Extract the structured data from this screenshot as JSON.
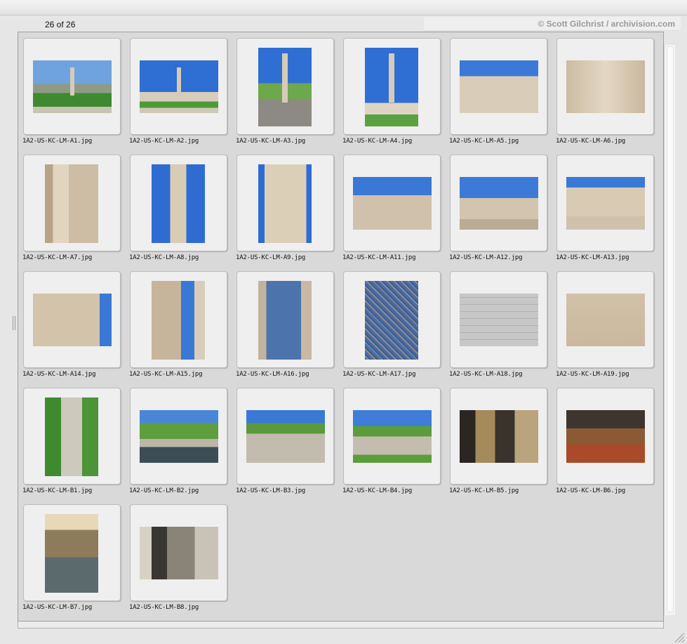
{
  "header": {
    "count": "26 of 26",
    "credit": "© Scott Gilchrist / archivision.com"
  },
  "thumbnails": [
    {
      "name": "1A2-US-KC-LM-A1.jpg",
      "scene": "memorial-distant-lawn"
    },
    {
      "name": "1A2-US-KC-LM-A2.jpg",
      "scene": "tower-wide-lawn"
    },
    {
      "name": "1A2-US-KC-LM-A3.jpg",
      "scene": "tower-path-portrait"
    },
    {
      "name": "1A2-US-KC-LM-A4.jpg",
      "scene": "tower-portrait-city"
    },
    {
      "name": "1A2-US-KC-LM-A5.jpg",
      "scene": "tower-base-terrace"
    },
    {
      "name": "1A2-US-KC-LM-A6.jpg",
      "scene": "tower-base-closeup"
    },
    {
      "name": "1A2-US-KC-LM-A7.jpg",
      "scene": "inscription-wall"
    },
    {
      "name": "1A2-US-KC-LM-A8.jpg",
      "scene": "tower-shaft"
    },
    {
      "name": "1A2-US-KC-LM-A9.jpg",
      "scene": "tower-shaft-detail"
    },
    {
      "name": "1A2-US-KC-LM-A11.jpg",
      "scene": "sphinx-terrace"
    },
    {
      "name": "1A2-US-KC-LM-A12.jpg",
      "scene": "sphinx-closeup"
    },
    {
      "name": "1A2-US-KC-LM-A13.jpg",
      "scene": "pavilion-building"
    },
    {
      "name": "1A2-US-KC-LM-A14.jpg",
      "scene": "building-windows"
    },
    {
      "name": "1A2-US-KC-LM-A15.jpg",
      "scene": "urn-colonnade"
    },
    {
      "name": "1A2-US-KC-LM-A16.jpg",
      "scene": "blue-tile-lantern"
    },
    {
      "name": "1A2-US-KC-LM-A17.jpg",
      "scene": "mosaic-panel"
    },
    {
      "name": "1A2-US-KC-LM-A18.jpg",
      "scene": "paving-plaque"
    },
    {
      "name": "1A2-US-KC-LM-A19.jpg",
      "scene": "stone-wall"
    },
    {
      "name": "1A2-US-KC-LM-B1.jpg",
      "scene": "aerial-mall"
    },
    {
      "name": "1A2-US-KC-LM-B2.jpg",
      "scene": "pool-terraces"
    },
    {
      "name": "1A2-US-KC-LM-B3.jpg",
      "scene": "round-pool"
    },
    {
      "name": "1A2-US-KC-LM-B4.jpg",
      "scene": "round-pool-lawn"
    },
    {
      "name": "1A2-US-KC-LM-B5.jpg",
      "scene": "interior-dark"
    },
    {
      "name": "1A2-US-KC-LM-B6.jpg",
      "scene": "interior-poppies"
    },
    {
      "name": "1A2-US-KC-LM-B7.jpg",
      "scene": "interior-skylight"
    },
    {
      "name": "1A2-US-KC-LM-B8.jpg",
      "scene": "interior-glass"
    }
  ],
  "colors": {
    "sky": "#3a7ad6",
    "stone": "#d8c9b2",
    "lawn": "#4f9a3a",
    "tile": "#4a6fa8"
  }
}
